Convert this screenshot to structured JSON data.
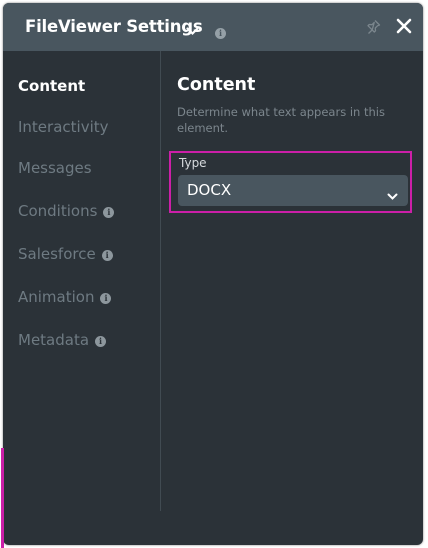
{
  "window": {
    "title": "FileViewer Settings",
    "info_glyph": "i"
  },
  "sidebar": {
    "items": [
      {
        "label": "Content",
        "active": true
      },
      {
        "label": "Interactivity"
      },
      {
        "label": "Messages"
      },
      {
        "label": "Conditions",
        "info": "i"
      },
      {
        "label": "Salesforce",
        "info": "i"
      },
      {
        "label": "Animation",
        "info": "i"
      },
      {
        "label": "Metadata",
        "info": "i"
      }
    ]
  },
  "content": {
    "title": "Content",
    "description": "Determine what text appears in this element.",
    "type_label": "Type",
    "type_value": "DOCX"
  },
  "colors": {
    "panel_bg": "#2b3238",
    "header_bg": "#49565f",
    "highlight": "#cc1fa8",
    "inactive_text": "#6e7a82"
  },
  "icons": [
    "chevron-down-icon",
    "info-icon",
    "pin-icon",
    "close-icon"
  ]
}
